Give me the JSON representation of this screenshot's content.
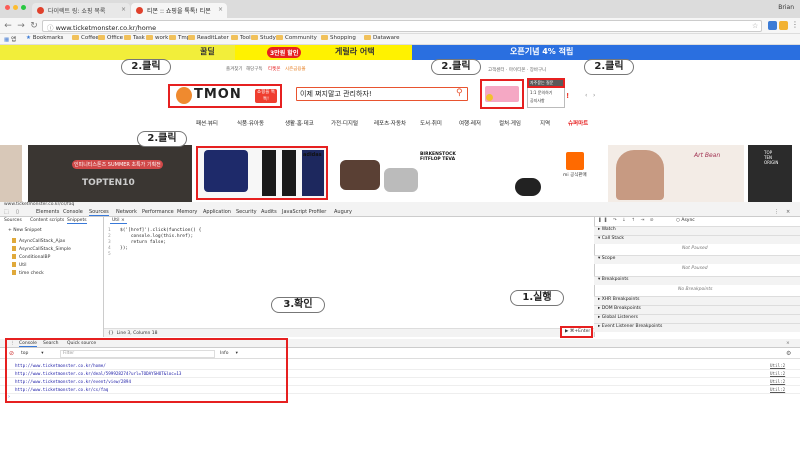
{
  "browser": {
    "tabs": [
      {
        "title": "다이렉트 링: 쇼핑 목록"
      },
      {
        "title": "티몬 :: 쇼핑을 톡톡! 티몬"
      }
    ],
    "user": "Brian",
    "url": "www.ticketmonster.co.kr/home",
    "bookmarks": [
      "앱",
      "Bookmarks",
      "Coffee",
      "Office",
      "Task",
      "work",
      "Tmp",
      "ReaditLater",
      "Tool",
      "Study",
      "Community",
      "Shopping",
      "Dataware"
    ]
  },
  "page": {
    "banner": [
      "꿀딜",
      "3만원 할인",
      "게릴라 어택",
      "오픈기념 4% 적립"
    ],
    "top_menu": [
      "즐겨찾기",
      "해당구독",
      "티켓몬",
      "시즌금융몰"
    ],
    "logo": "TMON",
    "logo_badge": "쇼핑을 톡톡!",
    "search_text": "이제 쩌지말고 관리하자!",
    "gnb": [
      "패션·뷰티",
      "식품·유아동",
      "생활·홈·데코",
      "가전·디지털",
      "레포츠·자동차",
      "도서·취미",
      "여행·레저",
      "컬처·게임",
      "지역",
      "슈퍼마트"
    ],
    "dropdown": [
      "자주묻는 질문",
      "1:1 문의하기",
      "공지사항"
    ],
    "promo": [
      "인피니티스톤즈 SUMMER 초특가 기획전",
      "TOPTEN10",
      "adidas",
      "BIRKENSTOCK FITFLOP TEVA",
      "mi 공식판매",
      "Art Bean",
      "TOP TEN ORIGIN"
    ]
  },
  "callouts": {
    "c1": "2.클릭",
    "c2": "2.클릭",
    "c3": "2.클릭",
    "c4": "2.클릭",
    "run": "1.실행",
    "check": "3.확인"
  },
  "devtools": {
    "status_url": "www.ticketmonster.co.kr/cs/faq",
    "tabs": [
      "Elements",
      "Console",
      "Sources",
      "Network",
      "Performance",
      "Memory",
      "Application",
      "Security",
      "Audits",
      "JavaScript Profiler",
      "Augury"
    ],
    "source_tabs": [
      "Sources",
      "Content scripts",
      "Snippets"
    ],
    "new_snippet": "+ New Snippet",
    "snippets": [
      "AsyncCallStack_Ajax",
      "AsyncCallStack_Simple",
      "ConditionalBP",
      "Util",
      "time check"
    ],
    "editor_tab": "Util",
    "code_lines": [
      "1",
      "2",
      "3",
      "4",
      "5"
    ],
    "code": [
      "$('[href]').click(function() {",
      "    console.log(this.href);",
      "    return false;",
      "});",
      ""
    ],
    "cursor": "Line 3, Column 18",
    "run_label": "▶ ⌘+Enter",
    "async": "Async",
    "right_sections": [
      "Watch",
      "Call Stack",
      "Scope",
      "Breakpoints",
      "XHR Breakpoints",
      "DOM Breakpoints",
      "Global Listeners",
      "Event Listener Breakpoints"
    ],
    "not_paused": "Not Paused",
    "no_breakpoints": "No Breakpoints",
    "console_tabs": [
      "Console",
      "Search",
      "Quick source"
    ],
    "context": "top",
    "filter_placeholder": "Filter",
    "level": "Info",
    "logs": [
      "http://www.ticketmonster.co.kr/home/",
      "http://www.ticketmonster.co.kr/deal/599928274?url=TODAYSHOT&loc=13",
      "http://www.ticketmonster.co.kr/event/view/2894",
      "http://www.ticketmonster.co.kr/cs/faq"
    ],
    "log_source": "Util:2"
  },
  "colors": {
    "accent_red": "#e62020",
    "tmon_orange": "#ef3e2f",
    "link_blue": "#1a1aa6"
  }
}
